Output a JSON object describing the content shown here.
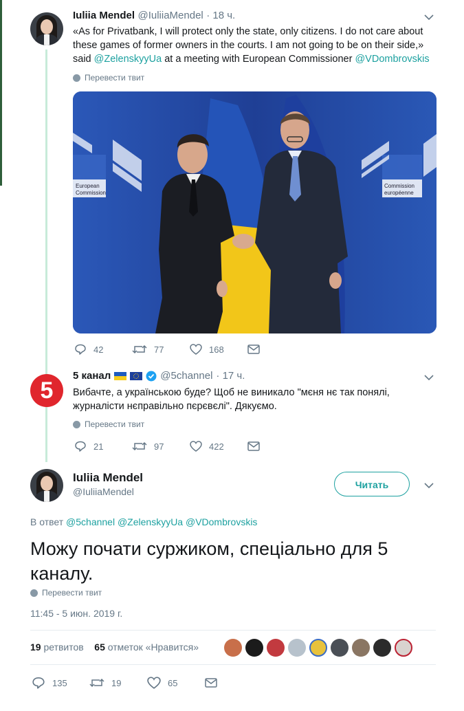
{
  "tweet1": {
    "name": "Iuliia Mendel",
    "handle": "@IuliiaMendel",
    "time": "· 18 ч.",
    "text_before": "«As for Privatbank, I will protect only the state, only citizens. I do not care about these games of former owners in the courts. I am not going to be on their side,» said ",
    "mention1": "@ZelenskyyUa",
    "text_mid": " at a meeting with European Commissioner ",
    "mention2": "@VDombrovskis",
    "translate": "Перевести твит",
    "replies": "42",
    "retweets": "77",
    "likes": "168",
    "photo_sign_left": "European Commission",
    "photo_sign_right": "Commission européenne"
  },
  "tweet2": {
    "logo": "5",
    "name": "5 канал",
    "handle": "@5channel",
    "time": "· 17 ч.",
    "text": "Вибачте, а українською буде? Щоб не виникало \"мєня нє так понялі, журналісти нєправільно пєрєвєлі\". Дякуємо.",
    "translate": "Перевести твит",
    "replies": "21",
    "retweets": "97",
    "likes": "422"
  },
  "tweet3": {
    "name": "Iuliia Mendel",
    "handle": "@IuliiaMendel",
    "follow_label": "Читать",
    "reply_prefix": "В ответ ",
    "reply_mentions": "@5channel @ZelenskyyUa @VDombrovskis",
    "text": "Можу почати суржиком, спеціально для 5 каналу.",
    "translate": "Перевести твит",
    "timestamp": "11:45 - 5 июн. 2019 г.",
    "retweet_count": "19",
    "retweet_label": "ретвитов",
    "like_count": "65",
    "like_label": "отметок «Нравится»",
    "replies": "135",
    "retweets": "19",
    "likes": "65"
  },
  "colors": {
    "accent": "#1da1a0",
    "thread_line": "#c7ebd9",
    "muted": "#657786",
    "channel5_red": "#e0262d"
  },
  "icons": [
    "chevron-down-icon",
    "globe-icon",
    "reply-icon",
    "retweet-icon",
    "heart-icon",
    "envelope-icon",
    "verified-badge-icon",
    "ukraine-flag-icon",
    "eu-flag-icon"
  ]
}
